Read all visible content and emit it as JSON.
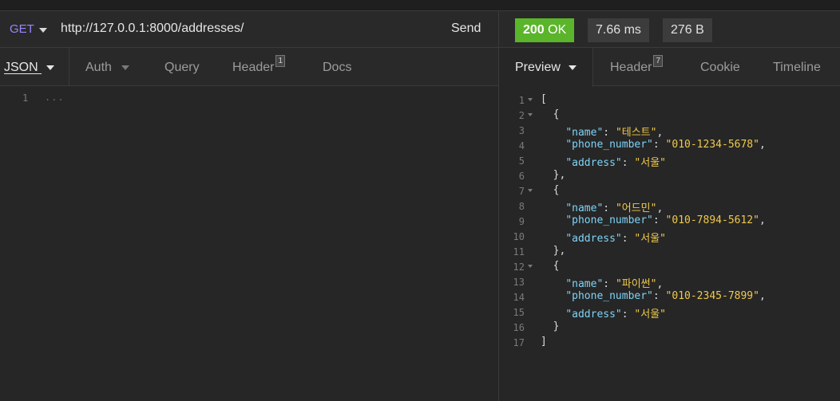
{
  "request": {
    "method": "GET",
    "url": "http://127.0.0.1:8000/addresses/",
    "send_label": "Send",
    "tabs": [
      {
        "label": "JSON"
      },
      {
        "label": "Auth"
      },
      {
        "label": "Query"
      },
      {
        "label": "Header",
        "badge": "1"
      },
      {
        "label": "Docs"
      }
    ],
    "body_line_number": "1",
    "body_placeholder": "..."
  },
  "response": {
    "status_code": "200",
    "status_text": "OK",
    "time": "7.66 ms",
    "size": "276 B",
    "tabs": [
      {
        "label": "Preview"
      },
      {
        "label": "Header",
        "badge": "7"
      },
      {
        "label": "Cookie"
      },
      {
        "label": "Timeline"
      }
    ],
    "lines": [
      {
        "n": "1",
        "fold": true,
        "parts": [
          [
            "p",
            "["
          ]
        ]
      },
      {
        "n": "2",
        "fold": true,
        "parts": [
          [
            "p",
            "  {"
          ]
        ]
      },
      {
        "n": "3",
        "fold": false,
        "parts": [
          [
            "p",
            "    "
          ],
          [
            "k",
            "\"name\""
          ],
          [
            "p",
            ": "
          ],
          [
            "s",
            "\"테스트\""
          ],
          [
            "p",
            ","
          ]
        ]
      },
      {
        "n": "4",
        "fold": false,
        "parts": [
          [
            "p",
            "    "
          ],
          [
            "k",
            "\"phone_number\""
          ],
          [
            "p",
            ": "
          ],
          [
            "s",
            "\"010-1234-5678\""
          ],
          [
            "p",
            ","
          ]
        ]
      },
      {
        "n": "5",
        "fold": false,
        "parts": [
          [
            "p",
            "    "
          ],
          [
            "k",
            "\"address\""
          ],
          [
            "p",
            ": "
          ],
          [
            "s",
            "\"서울\""
          ]
        ]
      },
      {
        "n": "6",
        "fold": false,
        "parts": [
          [
            "p",
            "  },"
          ]
        ]
      },
      {
        "n": "7",
        "fold": true,
        "parts": [
          [
            "p",
            "  {"
          ]
        ]
      },
      {
        "n": "8",
        "fold": false,
        "parts": [
          [
            "p",
            "    "
          ],
          [
            "k",
            "\"name\""
          ],
          [
            "p",
            ": "
          ],
          [
            "s",
            "\"어드민\""
          ],
          [
            "p",
            ","
          ]
        ]
      },
      {
        "n": "9",
        "fold": false,
        "parts": [
          [
            "p",
            "    "
          ],
          [
            "k",
            "\"phone_number\""
          ],
          [
            "p",
            ": "
          ],
          [
            "s",
            "\"010-7894-5612\""
          ],
          [
            "p",
            ","
          ]
        ]
      },
      {
        "n": "10",
        "fold": false,
        "parts": [
          [
            "p",
            "    "
          ],
          [
            "k",
            "\"address\""
          ],
          [
            "p",
            ": "
          ],
          [
            "s",
            "\"서울\""
          ]
        ]
      },
      {
        "n": "11",
        "fold": false,
        "parts": [
          [
            "p",
            "  },"
          ]
        ]
      },
      {
        "n": "12",
        "fold": true,
        "parts": [
          [
            "p",
            "  {"
          ]
        ]
      },
      {
        "n": "13",
        "fold": false,
        "parts": [
          [
            "p",
            "    "
          ],
          [
            "k",
            "\"name\""
          ],
          [
            "p",
            ": "
          ],
          [
            "s",
            "\"파이썬\""
          ],
          [
            "p",
            ","
          ]
        ]
      },
      {
        "n": "14",
        "fold": false,
        "parts": [
          [
            "p",
            "    "
          ],
          [
            "k",
            "\"phone_number\""
          ],
          [
            "p",
            ": "
          ],
          [
            "s",
            "\"010-2345-7899\""
          ],
          [
            "p",
            ","
          ]
        ]
      },
      {
        "n": "15",
        "fold": false,
        "parts": [
          [
            "p",
            "    "
          ],
          [
            "k",
            "\"address\""
          ],
          [
            "p",
            ": "
          ],
          [
            "s",
            "\"서울\""
          ]
        ]
      },
      {
        "n": "16",
        "fold": false,
        "parts": [
          [
            "p",
            "  }"
          ]
        ]
      },
      {
        "n": "17",
        "fold": false,
        "parts": [
          [
            "p",
            "]"
          ]
        ]
      }
    ]
  },
  "colors": {
    "status_ok": "#5ab52b",
    "method": "#9a86ff",
    "json_key": "#7fd3f7",
    "json_string": "#f0c94c"
  },
  "icons": [
    "method-dropdown-caret-icon",
    "tab-dropdown-caret-icon",
    "fold-arrow-icon"
  ]
}
